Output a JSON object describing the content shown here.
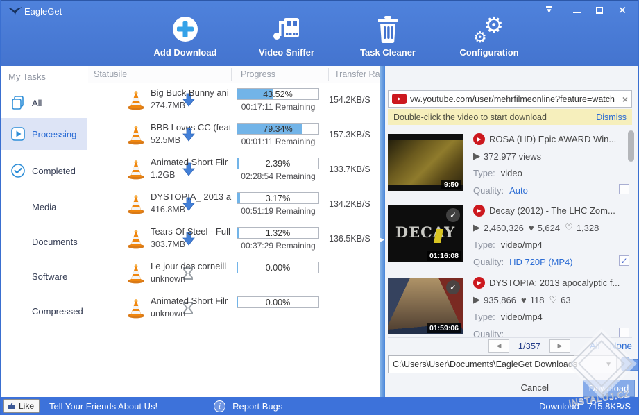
{
  "colors": {
    "accent_blue": "#4474cf",
    "link_blue": "#2b6cd4",
    "progress_fill": "#72b4e8",
    "youtube_red": "#cc181e",
    "hint_yellow": "#f6efbc",
    "footer_blue": "#3d72da"
  },
  "window": {
    "title": "EagleGet",
    "controls": [
      {
        "name": "minimize-to-tray-button",
        "icon": "tray-arrow-icon"
      },
      {
        "name": "minimize-button",
        "icon": "minimize-icon"
      },
      {
        "name": "maximize-button",
        "icon": "maximize-icon"
      },
      {
        "name": "close-button",
        "icon": "close-icon"
      }
    ]
  },
  "toolbar": {
    "buttons": [
      {
        "label": "Add Download",
        "icon": "plus-circle-icon"
      },
      {
        "label": "Video Sniffer",
        "icon": "music-film-icon"
      },
      {
        "label": "Task Cleaner",
        "icon": "trash-icon"
      },
      {
        "label": "Configuration",
        "icon": "gears-icon"
      }
    ]
  },
  "sidebar": {
    "header": "My Tasks",
    "items": [
      {
        "label": "All",
        "icon": "documents-icon",
        "selected": false
      },
      {
        "label": "Processing",
        "icon": "play-square-icon",
        "selected": true
      },
      {
        "label": "Completed",
        "icon": "check-circle-icon",
        "selected": false
      },
      {
        "label": "Media",
        "icon": "",
        "selected": false
      },
      {
        "label": "Documents",
        "icon": "",
        "selected": false
      },
      {
        "label": "Software",
        "icon": "",
        "selected": false
      },
      {
        "label": "Compressed",
        "icon": "",
        "selected": false
      }
    ]
  },
  "table": {
    "columns": [
      "Status",
      "File",
      "Progress",
      "Transfer Rate/Date Comp"
    ],
    "rows": [
      {
        "status": "downloading",
        "file": "Big Buck Bunny ani",
        "size": "274.7MB",
        "progress_label": "43.52%",
        "progress_value": 43.52,
        "remaining": "00:17:11 Remaining",
        "rate": "154.2KB/S"
      },
      {
        "status": "downloading",
        "file": "BBB Loves CC (feat",
        "size": "52.5MB",
        "progress_label": "79.34%",
        "progress_value": 79.34,
        "remaining": "00:01:11 Remaining",
        "rate": "157.3KB/S"
      },
      {
        "status": "downloading",
        "file": "Animated Short Filr",
        "size": "1.2GB",
        "progress_label": "2.39%",
        "progress_value": 2.39,
        "remaining": "02:28:54 Remaining",
        "rate": "133.7KB/S"
      },
      {
        "status": "downloading",
        "file": "DYSTOPIA_ 2013 ap",
        "size": "416.8MB",
        "progress_label": "3.17%",
        "progress_value": 3.17,
        "remaining": "00:51:19 Remaining",
        "rate": "134.2KB/S"
      },
      {
        "status": "downloading",
        "file": "Tears Of Steel - Full",
        "size": "303.7MB",
        "progress_label": "1.32%",
        "progress_value": 1.32,
        "remaining": "00:37:29 Remaining",
        "rate": "136.5KB/S"
      },
      {
        "status": "queued",
        "file": "Le jour des corneill",
        "size": "unknown",
        "progress_label": "0.00%",
        "progress_value": 0,
        "remaining": "",
        "rate": ""
      },
      {
        "status": "queued",
        "file": "Animated Short Filr",
        "size": "unknown",
        "progress_label": "0.00%",
        "progress_value": 0,
        "remaining": "",
        "rate": ""
      }
    ],
    "file_icon": "vlc-cone-icon",
    "status_icons": {
      "downloading": "down-arrow-icon",
      "queued": "hourglass-icon"
    }
  },
  "sniffer": {
    "url": "vw.youtube.com/user/mehrfilmeonline?feature=watch",
    "url_icon": "youtube-icon",
    "hint": "Double-click the video to start download",
    "dismiss": "Dismiss",
    "labels": {
      "type": "Type:",
      "quality": "Quality:"
    },
    "videos": [
      {
        "title": "ROSA (HD) Epic AWARD Win...",
        "duration": "9:50",
        "thumb": "rosa",
        "thumb_text": "",
        "stats": [
          {
            "icon": "play-icon",
            "value": "372,977 views"
          }
        ],
        "type": "video",
        "quality": "Auto",
        "checked": false,
        "badge": false
      },
      {
        "title": "Decay (2012) - The LHC Zom...",
        "duration": "01:16:08",
        "thumb": "decay",
        "thumb_text": "DECAY",
        "stats": [
          {
            "icon": "play-icon",
            "value": "2,460,326"
          },
          {
            "icon": "heart-icon",
            "value": "5,624"
          },
          {
            "icon": "heart-outline-icon",
            "value": "1,328"
          }
        ],
        "type": "video/mp4",
        "quality": "HD 720P (MP4)",
        "checked": true,
        "badge": true
      },
      {
        "title": "DYSTOPIA: 2013 apocalyptic f...",
        "duration": "01:59:06",
        "thumb": "dystopia",
        "thumb_text": "",
        "stats": [
          {
            "icon": "play-icon",
            "value": "935,866"
          },
          {
            "icon": "heart-icon",
            "value": "118"
          },
          {
            "icon": "heart-outline-icon",
            "value": "63"
          }
        ],
        "type": "video/mp4",
        "quality": "",
        "checked": false,
        "badge": true
      }
    ],
    "pager": {
      "page": "1/357",
      "all": "All",
      "none": "None"
    },
    "path": "C:\\Users\\User\\Documents\\EagleGet Downloads",
    "cancel": "Cancel",
    "download": "Download"
  },
  "watermark": {
    "text": "INSTALUJ.CZ"
  },
  "footer": {
    "like": "Like",
    "tell": "Tell Your Friends About Us!",
    "report": "Report Bugs",
    "download_label": "Download",
    "speed": "715.8KB/S"
  }
}
